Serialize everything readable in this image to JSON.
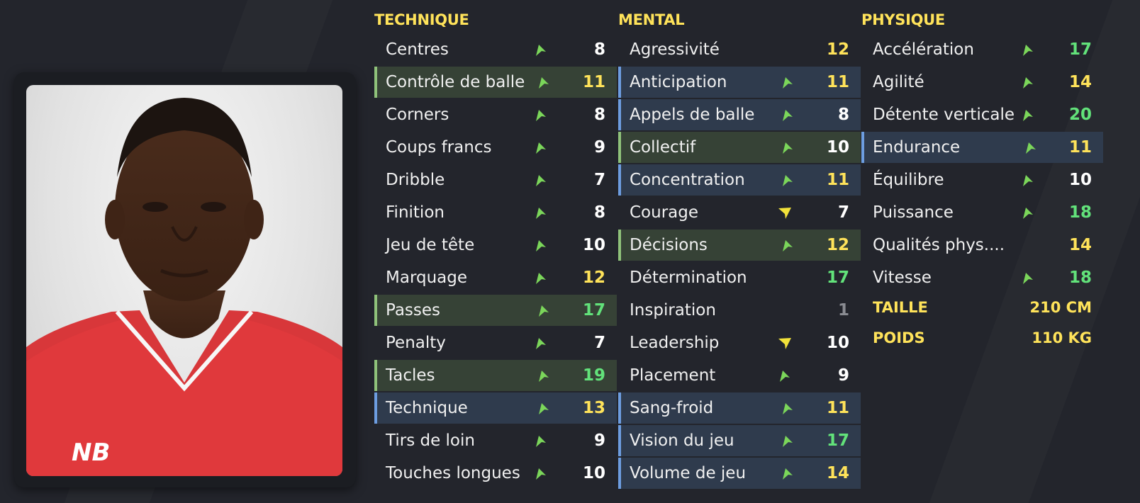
{
  "sections": {
    "technique": {
      "title": "TECHNIQUE",
      "rows": [
        {
          "name": "Centres",
          "value": "8",
          "arrow": "up",
          "hl": "",
          "vc": "v-white"
        },
        {
          "name": "Contrôle de balle",
          "value": "11",
          "arrow": "up",
          "hl": "hl-green",
          "vc": "v-yellow"
        },
        {
          "name": "Corners",
          "value": "8",
          "arrow": "up",
          "hl": "",
          "vc": "v-white"
        },
        {
          "name": "Coups francs",
          "value": "9",
          "arrow": "up",
          "hl": "",
          "vc": "v-white"
        },
        {
          "name": "Dribble",
          "value": "7",
          "arrow": "up",
          "hl": "",
          "vc": "v-white"
        },
        {
          "name": "Finition",
          "value": "8",
          "arrow": "up",
          "hl": "",
          "vc": "v-white"
        },
        {
          "name": "Jeu de tête",
          "value": "10",
          "arrow": "up",
          "hl": "",
          "vc": "v-white"
        },
        {
          "name": "Marquage",
          "value": "12",
          "arrow": "up",
          "hl": "",
          "vc": "v-yellow"
        },
        {
          "name": "Passes",
          "value": "17",
          "arrow": "up",
          "hl": "hl-green",
          "vc": "v-green"
        },
        {
          "name": "Penalty",
          "value": "7",
          "arrow": "up",
          "hl": "",
          "vc": "v-white"
        },
        {
          "name": "Tacles",
          "value": "19",
          "arrow": "up",
          "hl": "hl-green",
          "vc": "v-green"
        },
        {
          "name": "Technique",
          "value": "13",
          "arrow": "up",
          "hl": "hl-blue",
          "vc": "v-yellow"
        },
        {
          "name": "Tirs de loin",
          "value": "9",
          "arrow": "up",
          "hl": "",
          "vc": "v-white"
        },
        {
          "name": "Touches longues",
          "value": "10",
          "arrow": "up",
          "hl": "",
          "vc": "v-white"
        }
      ]
    },
    "mental": {
      "title": "MENTAL",
      "rows": [
        {
          "name": "Agressivité",
          "value": "12",
          "arrow": "none",
          "hl": "",
          "vc": "v-yellow"
        },
        {
          "name": "Anticipation",
          "value": "11",
          "arrow": "up",
          "hl": "hl-blue",
          "vc": "v-yellow"
        },
        {
          "name": "Appels de balle",
          "value": "8",
          "arrow": "up",
          "hl": "hl-blue",
          "vc": "v-white"
        },
        {
          "name": "Collectif",
          "value": "10",
          "arrow": "up",
          "hl": "hl-green",
          "vc": "v-white"
        },
        {
          "name": "Concentration",
          "value": "11",
          "arrow": "up",
          "hl": "hl-blue",
          "vc": "v-yellow"
        },
        {
          "name": "Courage",
          "value": "7",
          "arrow": "side",
          "hl": "",
          "vc": "v-white"
        },
        {
          "name": "Décisions",
          "value": "12",
          "arrow": "up",
          "hl": "hl-green",
          "vc": "v-yellow"
        },
        {
          "name": "Détermination",
          "value": "17",
          "arrow": "none",
          "hl": "",
          "vc": "v-green"
        },
        {
          "name": "Inspiration",
          "value": "1",
          "arrow": "none",
          "hl": "",
          "vc": "v-grey"
        },
        {
          "name": "Leadership",
          "value": "10",
          "arrow": "side",
          "hl": "",
          "vc": "v-white"
        },
        {
          "name": "Placement",
          "value": "9",
          "arrow": "up",
          "hl": "",
          "vc": "v-white"
        },
        {
          "name": "Sang-froid",
          "value": "11",
          "arrow": "up",
          "hl": "hl-blue",
          "vc": "v-yellow"
        },
        {
          "name": "Vision du jeu",
          "value": "17",
          "arrow": "up",
          "hl": "hl-blue",
          "vc": "v-green"
        },
        {
          "name": "Volume de jeu",
          "value": "14",
          "arrow": "up",
          "hl": "hl-blue",
          "vc": "v-yellow"
        }
      ]
    },
    "physique": {
      "title": "PHYSIQUE",
      "rows": [
        {
          "name": "Accélération",
          "value": "17",
          "arrow": "up",
          "hl": "",
          "vc": "v-green"
        },
        {
          "name": "Agilité",
          "value": "14",
          "arrow": "up",
          "hl": "",
          "vc": "v-yellow"
        },
        {
          "name": "Détente verticale",
          "value": "20",
          "arrow": "up",
          "hl": "",
          "vc": "v-green"
        },
        {
          "name": "Endurance",
          "value": "11",
          "arrow": "up",
          "hl": "hl-blue",
          "vc": "v-yellow"
        },
        {
          "name": "Équilibre",
          "value": "10",
          "arrow": "up",
          "hl": "",
          "vc": "v-white"
        },
        {
          "name": "Puissance",
          "value": "18",
          "arrow": "up",
          "hl": "",
          "vc": "v-green"
        },
        {
          "name": "Qualités phys....",
          "value": "14",
          "arrow": "none",
          "hl": "",
          "vc": "v-yellow"
        },
        {
          "name": "Vitesse",
          "value": "18",
          "arrow": "up",
          "hl": "",
          "vc": "v-green"
        }
      ]
    }
  },
  "info": {
    "height_label": "TAILLE",
    "height_value": "210 CM",
    "weight_label": "POIDS",
    "weight_value": "110 KG"
  },
  "colors": {
    "accent_yellow": "#ffe35a",
    "value_green": "#62e27a",
    "arrow_up": "#7bd65a",
    "arrow_side": "#f2e23a"
  },
  "icons": {
    "arrow_up": "trend-up-arrow-icon",
    "arrow_side": "trend-flat-arrow-icon"
  }
}
